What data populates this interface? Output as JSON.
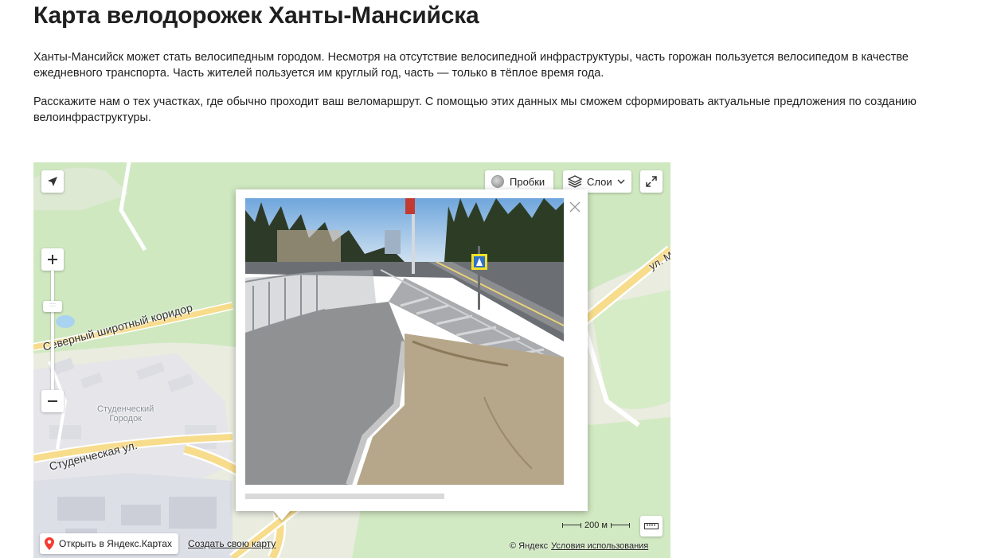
{
  "page": {
    "title": "Карта велодорожек Ханты-Мансийска",
    "intro_1": "Ханты-Мансийск может стать велосипедным городом. Несмотря на отсутствие велосипедной инфраструктуры, часть горожан пользуется велосипедом в качестве ежедневного транспорта. Часть жителей пользуется им круглый год, часть — только в тёплое время года.",
    "intro_2": "Расскажите нам о тех участках, где обычно проходит ваш веломаршрут. С помощью этих данных мы сможем сформировать актуальные предложения по созданию велоинфраструктуры."
  },
  "map": {
    "controls": {
      "traffic_label": "Пробки",
      "layers_label": "Слои",
      "zoom_handle_grip": "::::"
    },
    "labels": {
      "north_corridor": "Северный широтный коридор",
      "student_street": "Студенческая ул.",
      "student_town_line1": "Студенческий",
      "student_town_line2": "Городок",
      "street_m": "ул. М"
    },
    "footer": {
      "open_in_yandex": "Открыть в Яндекс.Картах",
      "create_map": "Создать свою карту",
      "scale": "200 м",
      "copyright": "© Яндекс",
      "terms": "Условия использования"
    },
    "colors": {
      "land": "#e9ecdf",
      "forest": "#cfe8c0",
      "road_major": "#f7dc8c",
      "water": "#a9d3ef",
      "pin_red": "#f43c30"
    }
  },
  "balloon": {
    "photo_description_icons": [
      "pedestrian-crossing-sign",
      "no-entry-sign"
    ]
  }
}
